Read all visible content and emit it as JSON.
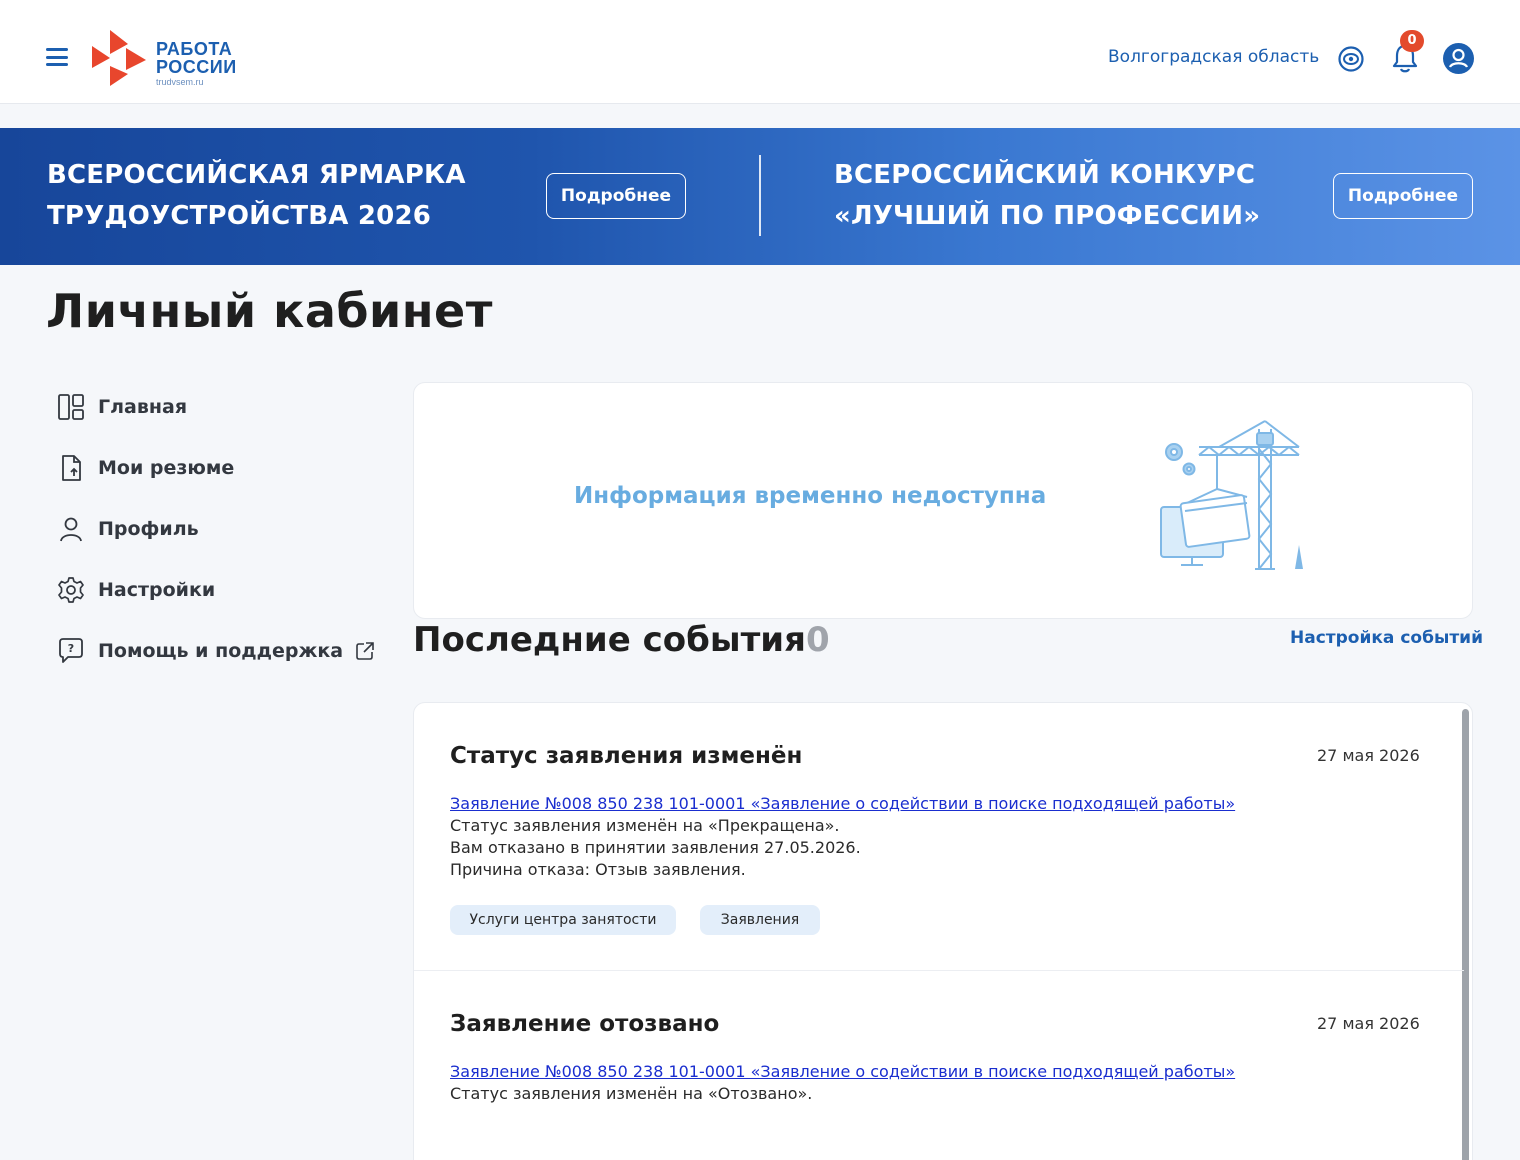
{
  "header": {
    "logo_line1": "РАБОТА",
    "logo_line2": "РОССИИ",
    "logo_sub": "trudvsem.ru",
    "region": "Волгоградская область",
    "notifications_count": "0",
    "icons": [
      "menu-icon",
      "eye-icon",
      "bell-icon",
      "user-icon"
    ]
  },
  "banner": {
    "left_title_1": "ВСЕРОССИЙСКАЯ ЯРМАРКА",
    "left_title_2": "ТРУДОУСТРОЙСТВА 2026",
    "left_button": "Подробнее",
    "right_title_1": "ВСЕРОССИЙСКИЙ КОНКУРС",
    "right_title_2": "«ЛУЧШИЙ ПО ПРОФЕССИИ»",
    "right_button": "Подробнее"
  },
  "page": {
    "title": "Личный кабинет"
  },
  "sidebar": {
    "items": [
      {
        "label": "Главная",
        "icon": "dashboard-icon"
      },
      {
        "label": "Мои резюме",
        "icon": "document-icon"
      },
      {
        "label": "Профиль",
        "icon": "user-icon"
      },
      {
        "label": "Настройки",
        "icon": "gear-icon"
      },
      {
        "label": "Помощь и поддержка",
        "icon": "help-chat-icon"
      }
    ]
  },
  "info": {
    "text": "Информация временно недоступна"
  },
  "events": {
    "title": "Последние события",
    "count": "0",
    "settings_link": "Настройка событий",
    "items": [
      {
        "title": "Статус заявления изменён",
        "date": "27 мая 2026",
        "link": "Заявление №008 850 238 101-0001 «Заявление о содействии в поиске подходящей работы»",
        "line1": "Статус заявления изменён на «Прекращена».",
        "line2": "Вам отказано в принятии заявления 27.05.2026.",
        "line3": "Причина отказа: Отзыв заявления.",
        "tag1": "Услуги центра занятости",
        "tag2": "Заявления"
      },
      {
        "title": "Заявление отозвано",
        "date": "27 мая 2026",
        "link": "Заявление №008 850 238 101-0001 «Заявление о содействии в поиске подходящей работы»",
        "line1": "Статус заявления изменён на «Отозвано»."
      }
    ]
  },
  "colors": {
    "brand": "#1c5fb0",
    "accent": "#e34a2c",
    "info": "#68ace0",
    "link": "#1a2ecf"
  }
}
